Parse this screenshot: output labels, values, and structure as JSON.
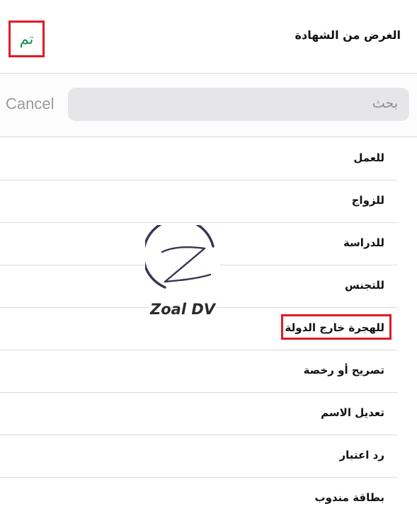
{
  "header": {
    "done_label": "تم",
    "title": "الغرض من الشهادة"
  },
  "search": {
    "placeholder": "بحث",
    "cancel_label": "Cancel"
  },
  "list": {
    "items": [
      {
        "label": "للعمل"
      },
      {
        "label": "للزواج"
      },
      {
        "label": "للدراسة"
      },
      {
        "label": "للتجنس"
      },
      {
        "label": "للهجرة خارج الدولة"
      },
      {
        "label": "تصريح أو رخصة"
      },
      {
        "label": "تعديل الاسم"
      },
      {
        "label": "رد اعتبار"
      },
      {
        "label": "بطاقة مندوب"
      }
    ],
    "highlighted_item": "للهجرة خارج الدولة"
  },
  "watermark": {
    "text": "Zoal DV"
  },
  "colors": {
    "done_green": "#0e8f4f",
    "highlight_red": "#e01b24",
    "search_field_bg": "#e6e6e8"
  }
}
